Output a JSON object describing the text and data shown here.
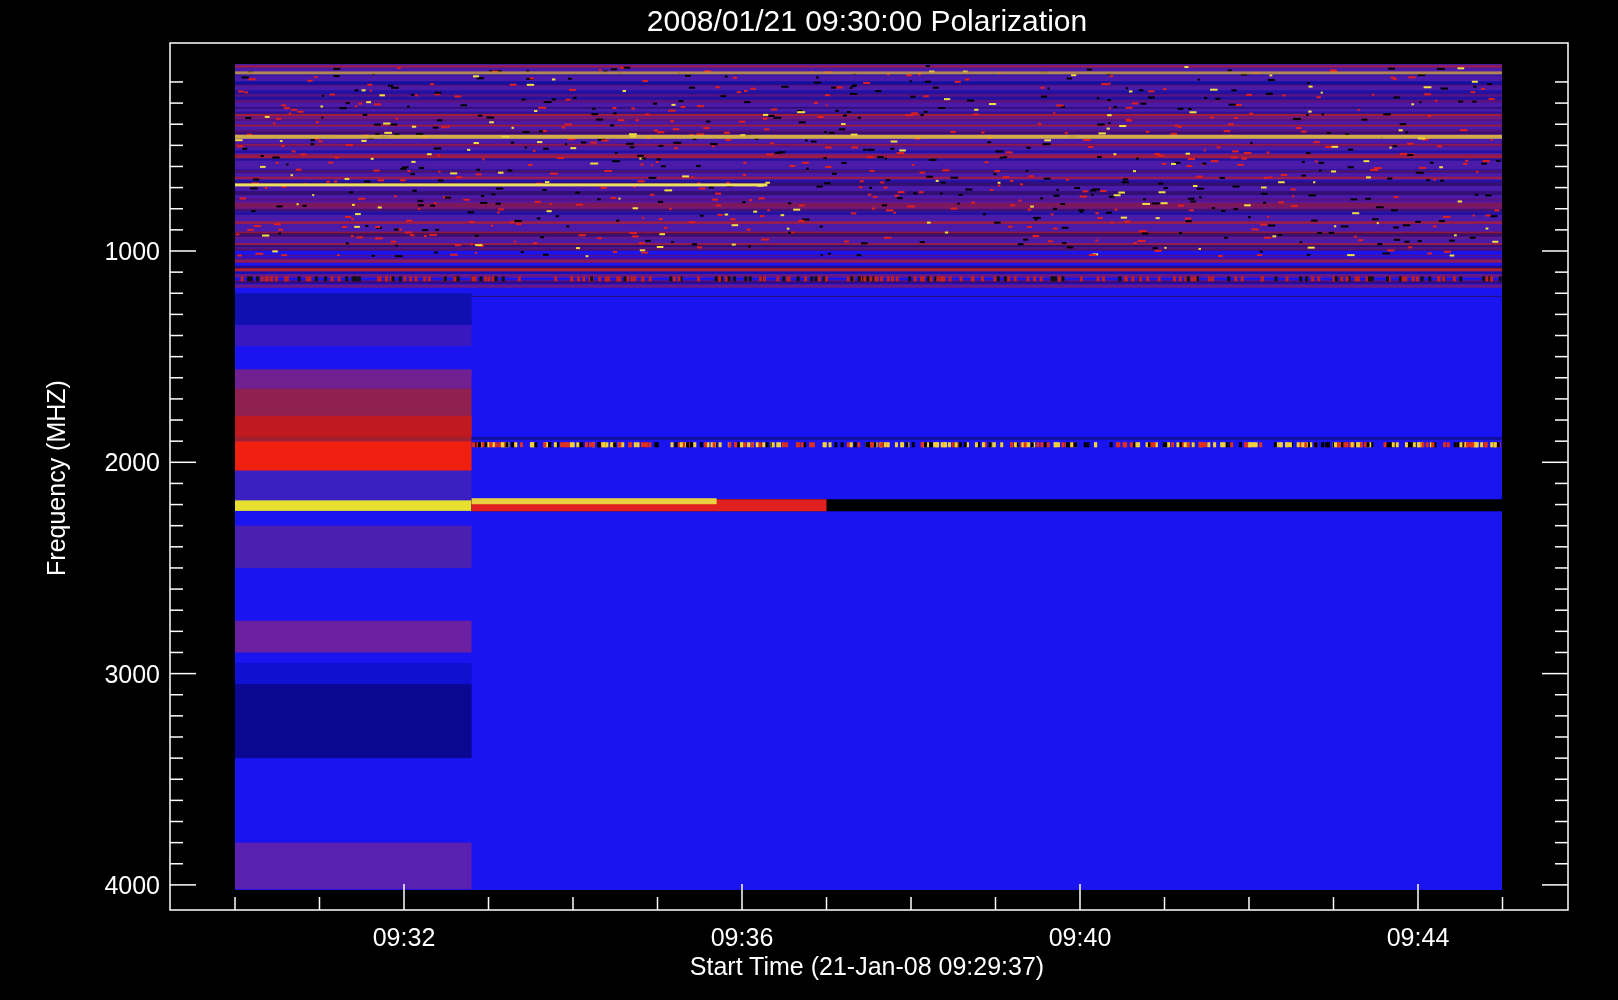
{
  "title": "2008/01/21 09:30:00 Polarization",
  "y_axis": {
    "label": "Frequency (MHZ)",
    "ticks": [
      "1000",
      "2000",
      "3000",
      "4000"
    ]
  },
  "x_axis": {
    "label": "Start Time (21-Jan-08 09:29:37)",
    "ticks": [
      "09:32",
      "09:36",
      "09:40",
      "09:44"
    ]
  }
}
